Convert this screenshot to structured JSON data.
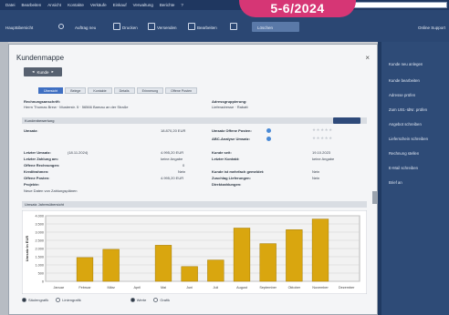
{
  "badge": "5-6/2024",
  "menubar": {
    "items": [
      "Datei",
      "Bearbeiten",
      "Ansicht",
      "Kontakte",
      "Verkäufe",
      "Einkauf",
      "Verwaltung",
      "Berichte",
      "?"
    ]
  },
  "toolbar": {
    "items": [
      "Hauptübersicht",
      "Auftrag neu",
      "Drucken",
      "Versenden",
      "Bearbeiten",
      "Löschen"
    ],
    "right_link": "Online Support"
  },
  "dialog": {
    "title": "Kundenmappe",
    "nav_label": "Kunde",
    "close_glyph": "×",
    "tabs": [
      "Übersicht",
      "Belege",
      "Kontakte",
      "Details",
      "Erinnerung",
      "Offene Posten"
    ],
    "address_label": "Rechnungsanschrift:",
    "address_value": "Herrn Thomas Brew · Musterstr. 5 · 56566 Barnau an der Straße",
    "delivery_label": "Adressgruppierung:",
    "delivery_value": "Lieferadresse · Rabatt",
    "section1": "Kundenbewertung",
    "rows_left": [
      {
        "label": "Umsatz:",
        "value": "18.870,20 EUR"
      },
      {
        "label": "Letzter Umsatz:",
        "value": "4.995,20 EUR",
        "date": "(18.11.2024)"
      },
      {
        "label": "Letzter Zahlung am:",
        "value": "keine Angabe"
      },
      {
        "label": "Offene Rechnungen:",
        "value": "0"
      },
      {
        "label": "Kreditrahmen:",
        "value": "Nein"
      },
      {
        "label": "Offene Posten:",
        "value": "4.995,20 EUR"
      },
      {
        "label": "Projekte:",
        "value": ""
      },
      {
        "label": "Neue Daten von Zahlungsplänen",
        "value": ""
      }
    ],
    "rows_right": [
      {
        "label": "Umsatz Offene Posten:"
      },
      {
        "label": "ABC-Analyse Umsatz:"
      },
      {
        "label": "Kunde seit:",
        "value": "19.10.2023"
      },
      {
        "label": "Letzter Kontakt:",
        "value": "keine Angabe"
      },
      {
        "label": "Kunde ist mehrfach gemeldet:",
        "value": "Nein"
      },
      {
        "label": "Zuschlag Lieferungen:",
        "value": "Nein"
      },
      {
        "label": "Direktzahlungen:",
        "value": ""
      }
    ],
    "section2": "Umsatz Jahresübersicht",
    "radios": [
      "Säulengrafik",
      "Liniengrafik",
      "Werte",
      "Grafik"
    ]
  },
  "chart_data": {
    "type": "bar",
    "ylabel": "Umsatz in EUR",
    "yticks": [
      "0",
      "500",
      "1.000",
      "1.500",
      "2.000",
      "2.500",
      "3.000",
      "3.500",
      "4.000"
    ],
    "ylim": [
      0,
      4000
    ],
    "categories": [
      "Januar",
      "Februar",
      "März",
      "April",
      "Mai",
      "Juni",
      "Juli",
      "August",
      "September",
      "Oktober",
      "November",
      "Dezember"
    ],
    "values": [
      0,
      1450,
      1950,
      0,
      2200,
      900,
      1300,
      3250,
      2300,
      3150,
      3800,
      0
    ],
    "grid": true,
    "bar_color": "#d9a60f"
  },
  "rightpanel": {
    "items": [
      "Kunde neu anlegen",
      "Kunde bearbeiten",
      "Adresse prüfen",
      "Zum USt.-IdNr. prüfen",
      "Angebot schreiben",
      "Lieferschein schreiben",
      "Rechnung stellen",
      "E-Mail schreiben",
      "Brief an"
    ]
  }
}
